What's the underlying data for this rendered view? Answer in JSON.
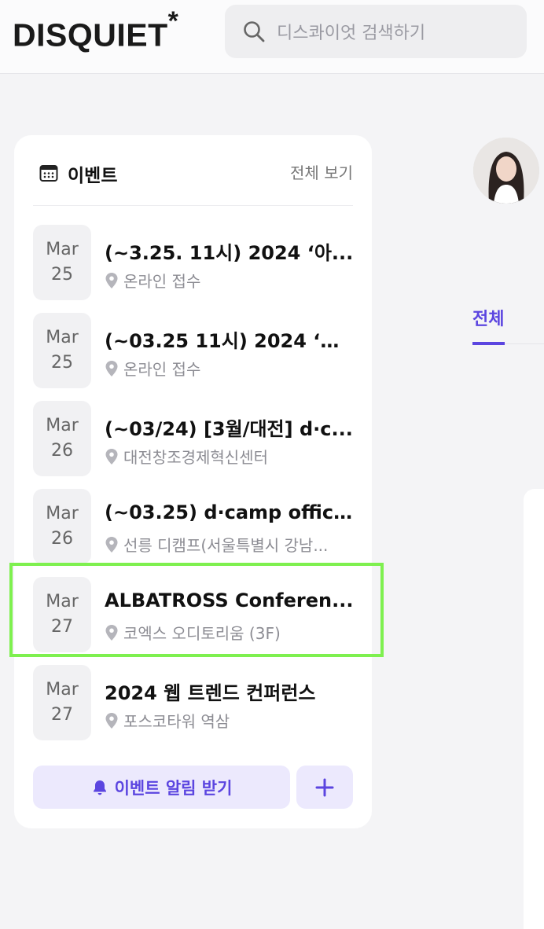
{
  "header": {
    "logo": "DISQUIET",
    "logo_mark": "*",
    "search": {
      "placeholder": "디스콰이엇 검색하기",
      "icon": "search-icon"
    }
  },
  "events_card": {
    "title": "이벤트",
    "view_all_label": "전체 보기",
    "icon": "calendar-icon",
    "items": [
      {
        "month": "Mar",
        "day": "25",
        "title": "(~3.25. 11시) 2024 ‘아...",
        "location": "온라인 접수"
      },
      {
        "month": "Mar",
        "day": "25",
        "title": "(~03.25 11시) 2024 ‘아...",
        "location": "온라인 접수"
      },
      {
        "month": "Mar",
        "day": "26",
        "title": "(~03/24) [3월/대전] d·c...",
        "location": "대전창조경제혁신센터"
      },
      {
        "month": "Mar",
        "day": "26",
        "title": "(~03.25) d·camp office...",
        "location": "선릉 디캠프(서울특별시 강남..."
      },
      {
        "month": "Mar",
        "day": "27",
        "title": "ALBATROSS Conferen...",
        "location": "코엑스 오디토리움 (3F)"
      },
      {
        "month": "Mar",
        "day": "27",
        "title": "2024 웹 트렌드 컨퍼런스",
        "location": "포스코타워 역삼"
      }
    ],
    "notify_button_label": "이벤트 알림 받기",
    "add_button_icon": "plus-icon"
  },
  "right_column": {
    "tab_all_label": "전체"
  },
  "colors": {
    "accent": "#5b45e0",
    "accent_bg": "#ece9fd",
    "highlight": "#7ef04f",
    "date_bg": "#f1f1f3"
  }
}
